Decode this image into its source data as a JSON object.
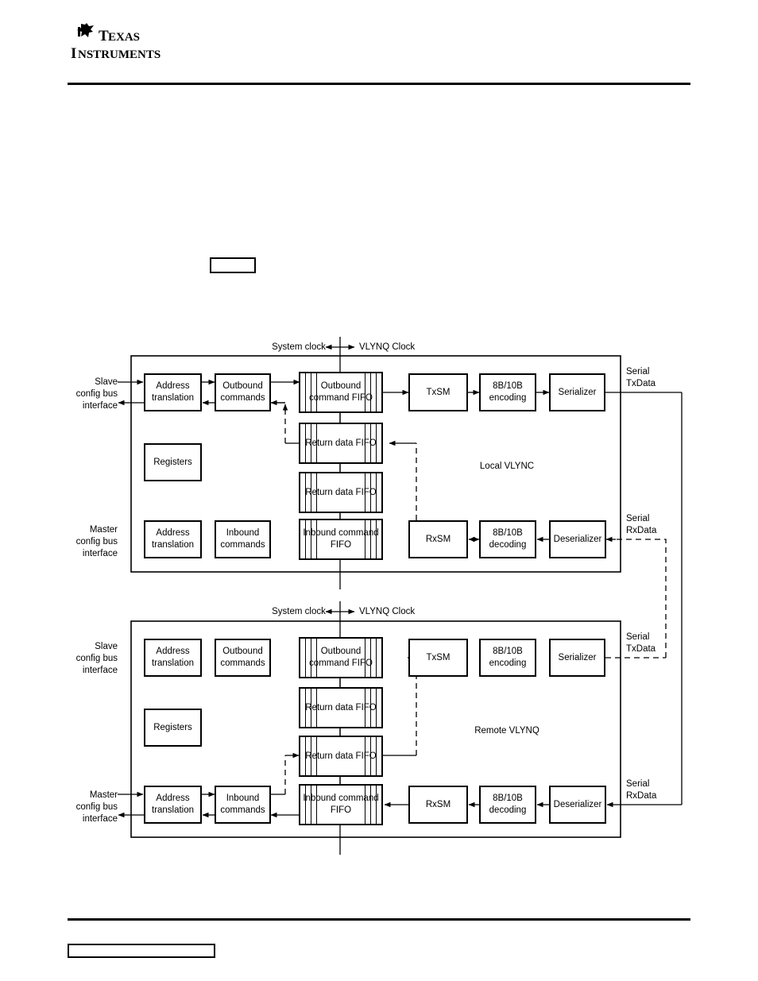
{
  "page": {
    "brand": "Texas Instruments",
    "logo_line1": "TEXAS",
    "logo_line2": "INSTRUMENTS",
    "caption_placeholder": "",
    "footer_placeholder": ""
  },
  "diagrams": [
    {
      "id": "local",
      "title": "Local VLYNC",
      "clock_left": "System clock",
      "clock_right": "VLYNQ Clock",
      "serial_tx": "Serial\nTxData",
      "serial_rx": "Serial\nRxData",
      "slave_interface": "Slave\nconfig bus\ninterface",
      "master_interface": "Master\nconfig bus\ninterface",
      "blocks": {
        "addr_top": "Address\ntranslation",
        "outbound_cmd": "Outbound\ncommands",
        "outbound_fifo": "Outbound\ncommand\nFIFO",
        "txsm": "TxSM",
        "enc": "8B/10B\nencoding",
        "ser": "Serializer",
        "return_fifo_1": "Return\ndata\nFIFO",
        "return_fifo_2": "Return\ndata\nFIFO",
        "registers": "Registers",
        "addr_bot": "Address\ntranslation",
        "inbound_cmd": "Inbound\ncommands",
        "inbound_fifo": "Inbound\ncommand\nFIFO",
        "rxsm": "RxSM",
        "dec": "8B/10B\ndecoding",
        "deser": "Deserializer"
      }
    },
    {
      "id": "remote",
      "title": "Remote VLYNQ",
      "clock_left": "System clock",
      "clock_right": "VLYNQ Clock",
      "serial_tx": "Serial\nTxData",
      "serial_rx": "Serial\nRxData",
      "slave_interface": "Slave\nconfig bus\ninterface",
      "master_interface": "Master\nconfig bus\ninterface",
      "blocks": {
        "addr_top": "Address\ntranslation",
        "outbound_cmd": "Outbound\ncommands",
        "outbound_fifo": "Outbound\ncommand\nFIFO",
        "txsm": "TxSM",
        "enc": "8B/10B\nencoding",
        "ser": "Serializer",
        "return_fifo_1": "Return\ndata\nFIFO",
        "return_fifo_2": "Return\ndata\nFIFO",
        "registers": "Registers",
        "addr_bot": "Address\ntranslation",
        "inbound_cmd": "Inbound\ncommands",
        "inbound_fifo": "Inbound\ncommand\nFIFO",
        "rxsm": "RxSM",
        "dec": "8B/10B\ndecoding",
        "deser": "Deserializer"
      }
    }
  ],
  "colors": {
    "ink": "#000000",
    "paper": "#ffffff"
  }
}
